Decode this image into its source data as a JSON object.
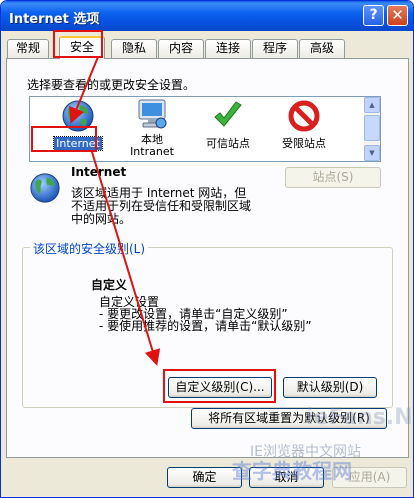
{
  "window": {
    "title": "Internet 选项",
    "help_glyph": "?",
    "close_glyph": "✕"
  },
  "tabs": [
    {
      "label": "常规"
    },
    {
      "label": "安全"
    },
    {
      "label": "隐私"
    },
    {
      "label": "内容"
    },
    {
      "label": "连接"
    },
    {
      "label": "程序"
    },
    {
      "label": "高级"
    }
  ],
  "security": {
    "zone_prompt": "选择要查看的或更改安全设置。",
    "zones": [
      {
        "label": "Internet",
        "icon": "globe-icon"
      },
      {
        "label": "本地",
        "label2": "Intranet",
        "icon": "computer-network-icon"
      },
      {
        "label": "可信站点",
        "icon": "checkmark-icon"
      },
      {
        "label": "受限站点",
        "icon": "no-entry-icon"
      }
    ],
    "selected_zone": {
      "name": "Internet",
      "desc1": "该区域适用于 Internet 网站，但",
      "desc2": "不适用于列在受信任和受限制区域",
      "desc3": "中的网站。"
    },
    "sites_button": "站点(S)",
    "level_group_title": "该区域的安全级别(L)",
    "level": {
      "name": "自定义",
      "line1": "自定义设置",
      "line2": "- 要更改设置，请单击“自定义级别”",
      "line3": "- 要使用推荐的设置，请单击“默认级别”"
    },
    "custom_level_button": "自定义级别(C)...",
    "default_level_button": "默认级别(D)",
    "reset_all_button": "将所有区域重置为默认级别(R)"
  },
  "footer": {
    "ok": "确定",
    "cancel": "取消",
    "apply": "应用(A)"
  },
  "watermark": {
    "line1": "ieFans.Net",
    "line2": "IE浏览器中文网站",
    "line3": "查字典教程网"
  }
}
